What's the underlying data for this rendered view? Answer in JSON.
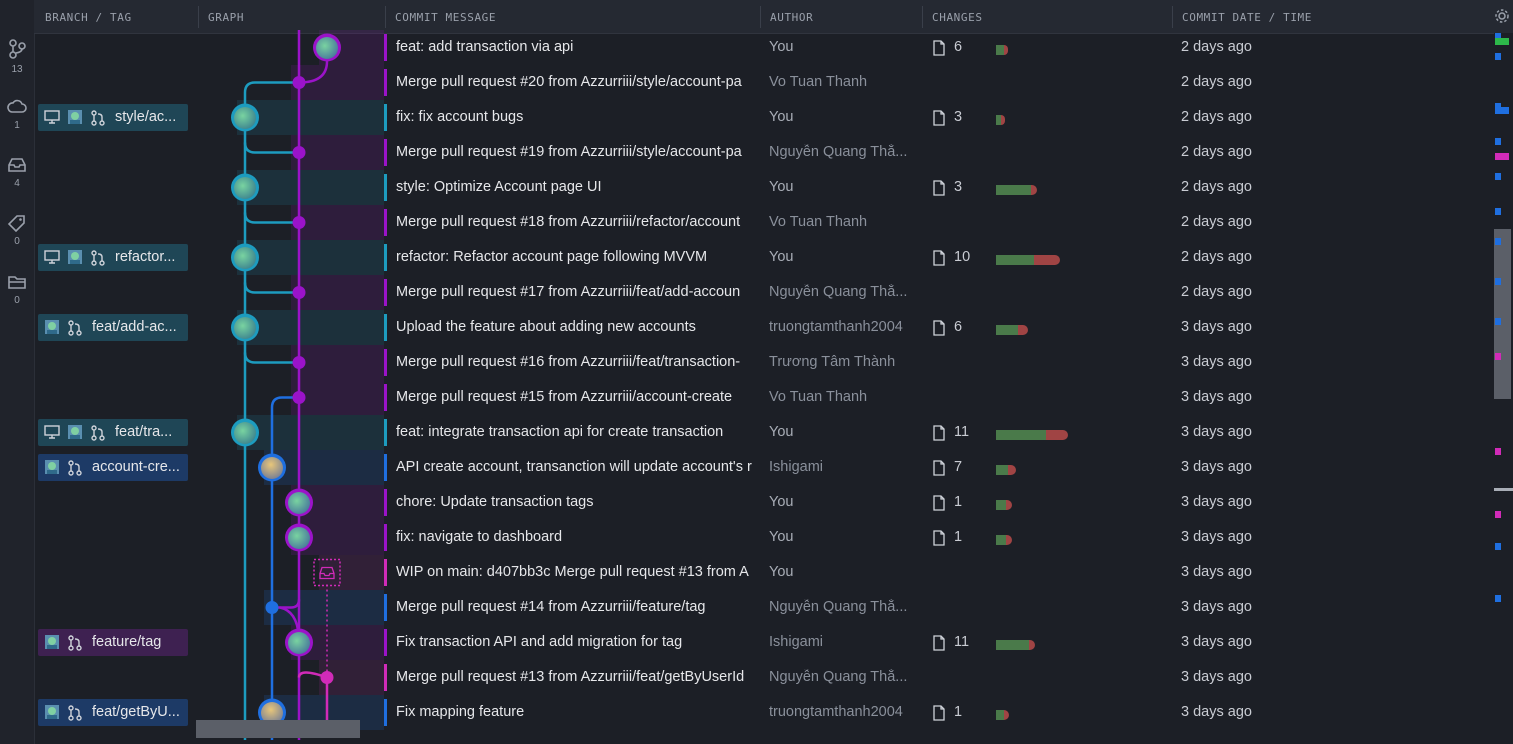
{
  "sidebar": [
    {
      "icon": "branch-icon",
      "count": "13"
    },
    {
      "icon": "cloud-icon",
      "count": "1"
    },
    {
      "icon": "stash-icon",
      "count": "4"
    },
    {
      "icon": "tag-icon",
      "count": "0"
    },
    {
      "icon": "folder-icon",
      "count": "0"
    }
  ],
  "header": {
    "branch_tag": "BRANCH / TAG",
    "graph": "GRAPH",
    "message": "COMMIT MESSAGE",
    "author": "AUTHOR",
    "changes": "CHANGES",
    "date": "COMMIT DATE / TIME"
  },
  "labels": {
    "l2": {
      "text": "style/ac...",
      "icons": [
        "computer-icon",
        "avatar-icon",
        "branch-icon"
      ],
      "color": "#1f4656"
    },
    "l6": {
      "text": "refactor...",
      "icons": [
        "computer-icon",
        "avatar-icon",
        "branch-icon"
      ],
      "color": "#1f4656"
    },
    "l8": {
      "text": "feat/add-ac...",
      "icons": [
        "avatar-icon",
        "branch-icon"
      ],
      "color": "#1f4656"
    },
    "l11": {
      "text": "feat/tra...",
      "icons": [
        "computer-icon",
        "avatar-icon",
        "branch-icon"
      ],
      "color": "#1f4656"
    },
    "l12": {
      "text": "account-cre...",
      "icons": [
        "avatar-icon",
        "branch-icon"
      ],
      "color": "#1d3a66"
    },
    "l17": {
      "text": "feature/tag",
      "icons": [
        "avatar-icon",
        "branch-icon"
      ],
      "color": "#3e2151"
    },
    "l19": {
      "text": "feat/getByU...",
      "icons": [
        "avatar-icon",
        "branch-icon"
      ],
      "color": "#1d3a66"
    }
  },
  "commits": [
    {
      "message": "feat: add transaction via api",
      "author": "You",
      "files": "6",
      "add": 0.08,
      "del": 0.04,
      "date": "2 days ago"
    },
    {
      "message": "Merge pull request #20 from Azzurriii/style/account-pa",
      "author": "Vo Tuan Thanh",
      "files": "",
      "add": 0,
      "del": 0,
      "date": "2 days ago"
    },
    {
      "message": "fix: fix account bugs",
      "author": "You",
      "files": "3",
      "add": 0.05,
      "del": 0.04,
      "date": "2 days ago"
    },
    {
      "message": "Merge pull request #19 from Azzurriii/style/account-pa",
      "author": "Nguyễn Quang Thắ...",
      "files": "",
      "add": 0,
      "del": 0,
      "date": "2 days ago"
    },
    {
      "message": "style: Optimize Account page UI",
      "author": "You",
      "files": "3",
      "add": 0.35,
      "del": 0.06,
      "date": "2 days ago"
    },
    {
      "message": "Merge pull request #18 from Azzurriii/refactor/account",
      "author": "Vo Tuan Thanh",
      "files": "",
      "add": 0,
      "del": 0,
      "date": "2 days ago"
    },
    {
      "message": "refactor: Refactor account page following MVVM",
      "author": "You",
      "files": "10",
      "add": 0.38,
      "del": 0.26,
      "date": "2 days ago"
    },
    {
      "message": "Merge pull request #17 from Azzurriii/feat/add-accoun",
      "author": "Nguyễn Quang Thắ...",
      "files": "",
      "add": 0,
      "del": 0,
      "date": "2 days ago"
    },
    {
      "message": "Upload the feature about adding new accounts",
      "author": "truongtamthanh2004",
      "files": "6",
      "add": 0.22,
      "del": 0.1,
      "date": "3 days ago"
    },
    {
      "message": "Merge pull request #16 from Azzurriii/feat/transaction-",
      "author": "Trương Tâm Thành",
      "files": "",
      "add": 0,
      "del": 0,
      "date": "3 days ago"
    },
    {
      "message": "Merge pull request #15 from Azzurriii/account-create",
      "author": "Vo Tuan Thanh",
      "files": "",
      "add": 0,
      "del": 0,
      "date": "3 days ago"
    },
    {
      "message": "feat: integrate transaction api for create transaction",
      "author": "You",
      "files": "11",
      "add": 0.5,
      "del": 0.22,
      "date": "3 days ago"
    },
    {
      "message": "API create account, transanction will update account's r",
      "author": "Ishigami",
      "files": "7",
      "add": 0.12,
      "del": 0.08,
      "date": "3 days ago"
    },
    {
      "message": "chore: Update transaction tags",
      "author": "You",
      "files": "1",
      "add": 0.1,
      "del": 0.06,
      "date": "3 days ago"
    },
    {
      "message": "fix: navigate to dashboard",
      "author": "You",
      "files": "1",
      "add": 0.1,
      "del": 0.06,
      "date": "3 days ago"
    },
    {
      "message": "WIP on main: d407bb3c Merge pull request #13 from A",
      "author": "You",
      "files": "",
      "add": 0,
      "del": 0,
      "date": "3 days ago"
    },
    {
      "message": "Merge pull request #14 from Azzurriii/feature/tag",
      "author": "Nguyễn Quang Thắ...",
      "files": "",
      "add": 0,
      "del": 0,
      "date": "3 days ago"
    },
    {
      "message": "Fix transaction API and add migration for tag",
      "author": "Ishigami",
      "files": "11",
      "add": 0.33,
      "del": 0.06,
      "date": "3 days ago"
    },
    {
      "message": "Merge pull request #13 from Azzurriii/feat/getByUserId",
      "author": "Nguyễn Quang Thắ...",
      "files": "",
      "add": 0,
      "del": 0,
      "date": "3 days ago"
    },
    {
      "message": "Fix mapping feature",
      "author": "truongtamthanh2004",
      "files": "1",
      "add": 0.08,
      "del": 0.05,
      "date": "3 days ago"
    }
  ],
  "colors": {
    "teal": "#1d9cbf",
    "purple": "#9b13c9",
    "blue": "#1f6fe0",
    "magenta": "#d12bb8",
    "add": "#4a7a4a",
    "del": "#a04444"
  }
}
